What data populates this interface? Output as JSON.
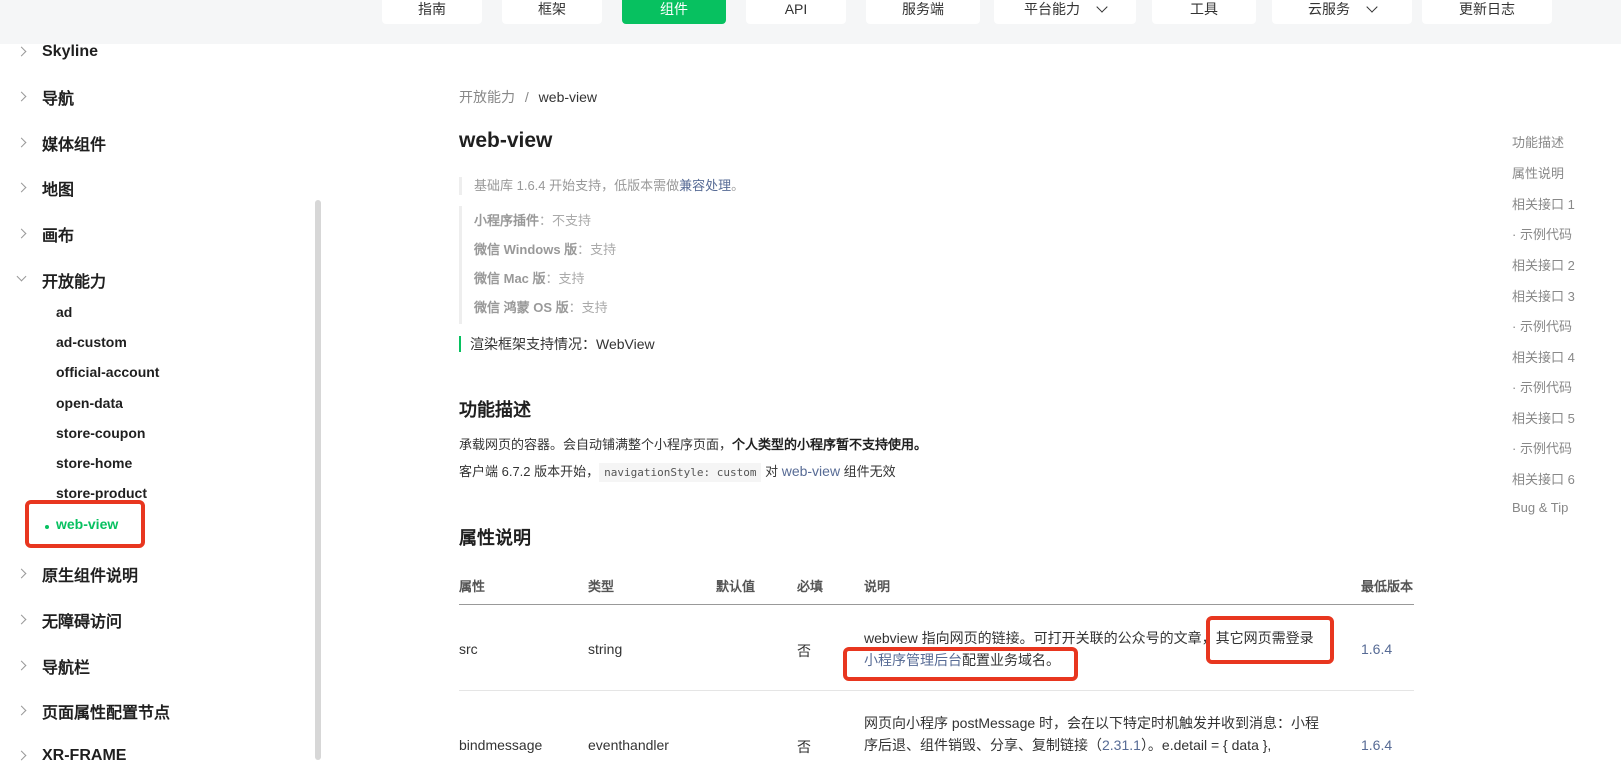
{
  "topnav": {
    "items": [
      {
        "label": "指南"
      },
      {
        "label": "框架"
      },
      {
        "label": "组件"
      },
      {
        "label": "API"
      },
      {
        "label": "服务端"
      },
      {
        "label": "平台能力"
      },
      {
        "label": "工具"
      },
      {
        "label": "云服务"
      },
      {
        "label": "更新日志"
      }
    ],
    "active_color": "#07c160"
  },
  "sidebar": {
    "items": [
      "Skyline",
      "导航",
      "媒体组件",
      "地图",
      "画布",
      "开放能力"
    ],
    "sub_items": [
      "ad",
      "ad-custom",
      "official-account",
      "open-data",
      "store-coupon",
      "store-home",
      "store-product",
      "web-view"
    ],
    "after_items": [
      "原生组件说明",
      "无障碍访问",
      "导航栏",
      "页面属性配置节点",
      "XR-FRAME"
    ]
  },
  "breadcrumb": {
    "parent": "开放能力",
    "sep": "/",
    "current": "web-view"
  },
  "page_title": "web-view",
  "base_note": {
    "text": "基础库 1.6.4 开始支持，低版本需做",
    "link": "兼容处理",
    "end": "。"
  },
  "support": [
    {
      "label": "小程序插件",
      "value": "：不支持"
    },
    {
      "label": "微信 Windows 版",
      "value": "：支持"
    },
    {
      "label": "微信 Mac 版",
      "value": "：支持"
    },
    {
      "label": "微信 鸿蒙 OS 版",
      "value": "：支持"
    }
  ],
  "render_note": "渲染框架支持情况：WebView",
  "func": {
    "title": "功能描述",
    "line1": "承载网页的容器。会自动铺满整个小程序页面，",
    "line1_bold": "个人类型的小程序暂不支持使用。",
    "line2_a": "客户端 6.7.2 版本开始，",
    "line2_code": "navigationStyle: custom",
    "line2_b": " 对 ",
    "line2_link": "web-view",
    "line2_c": " 组件无效"
  },
  "props": {
    "title": "属性说明",
    "headers": [
      "属性",
      "类型",
      "默认值",
      "必填",
      "说明",
      "最低版本"
    ],
    "rows": [
      {
        "name": "src",
        "type": "string",
        "default": "",
        "required": "否",
        "desc_a": "webview 指向网页的链接。可打开关联的公众号的文章，其它网页需登录",
        "desc_link": "小程序管理后台",
        "desc_b": "配置业务域名。",
        "version": "1.6.4"
      },
      {
        "name": "bindmessage",
        "type": "eventhandler",
        "default": "",
        "required": "否",
        "desc_a": "网页向小程序 postMessage 时，会在以下特定时机触发并收到消息：小程序后退、组件销毁、分享、复制链接（",
        "desc_link": "2.31.1",
        "desc_b": "）。e.detail = { data },",
        "version": "1.6.4"
      }
    ]
  },
  "toc": [
    "功能描述",
    "属性说明",
    "相关接口 1",
    "· 示例代码",
    "相关接口 2",
    "相关接口 3",
    "· 示例代码",
    "相关接口 4",
    "· 示例代码",
    "相关接口 5",
    "· 示例代码",
    "相关接口 6",
    "Bug & Tip"
  ]
}
